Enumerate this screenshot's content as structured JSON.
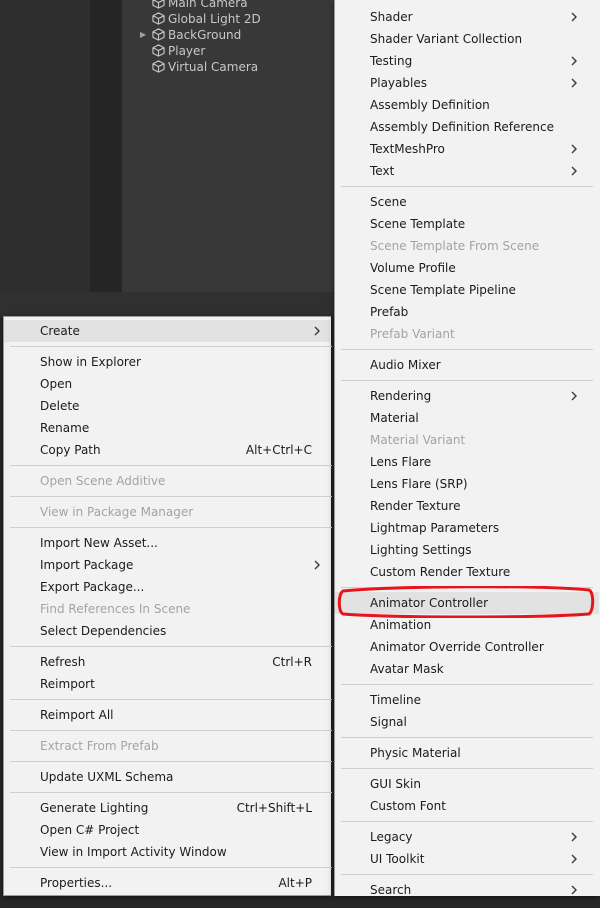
{
  "hierarchy": {
    "items": [
      {
        "label": "Main Camera",
        "expandable": false
      },
      {
        "label": "Global Light 2D",
        "expandable": false
      },
      {
        "label": "BackGround",
        "expandable": true
      },
      {
        "label": "Player",
        "expandable": false
      },
      {
        "label": "Virtual Camera",
        "expandable": false
      }
    ]
  },
  "context_menu": {
    "items": [
      {
        "label": "Create",
        "submenu": true,
        "highlight": true
      },
      {
        "sep": true
      },
      {
        "label": "Show in Explorer"
      },
      {
        "label": "Open"
      },
      {
        "label": "Delete"
      },
      {
        "label": "Rename"
      },
      {
        "label": "Copy Path",
        "shortcut": "Alt+Ctrl+C"
      },
      {
        "sep": true
      },
      {
        "label": "Open Scene Additive",
        "disabled": true
      },
      {
        "sep": true
      },
      {
        "label": "View in Package Manager",
        "disabled": true
      },
      {
        "sep": true
      },
      {
        "label": "Import New Asset..."
      },
      {
        "label": "Import Package",
        "submenu": true
      },
      {
        "label": "Export Package..."
      },
      {
        "label": "Find References In Scene",
        "disabled": true
      },
      {
        "label": "Select Dependencies"
      },
      {
        "sep": true
      },
      {
        "label": "Refresh",
        "shortcut": "Ctrl+R"
      },
      {
        "label": "Reimport"
      },
      {
        "sep": true
      },
      {
        "label": "Reimport All"
      },
      {
        "sep": true
      },
      {
        "label": "Extract From Prefab",
        "disabled": true
      },
      {
        "sep": true
      },
      {
        "label": "Update UXML Schema"
      },
      {
        "sep": true
      },
      {
        "label": "Generate Lighting",
        "shortcut": "Ctrl+Shift+L"
      },
      {
        "label": "Open C# Project"
      },
      {
        "label": "View in Import Activity Window"
      },
      {
        "sep": true
      },
      {
        "label": "Properties...",
        "shortcut": "Alt+P"
      }
    ]
  },
  "create_submenu": {
    "items": [
      {
        "label": "Shader",
        "submenu": true
      },
      {
        "label": "Shader Variant Collection"
      },
      {
        "label": "Testing",
        "submenu": true
      },
      {
        "label": "Playables",
        "submenu": true
      },
      {
        "label": "Assembly Definition"
      },
      {
        "label": "Assembly Definition Reference"
      },
      {
        "label": "TextMeshPro",
        "submenu": true
      },
      {
        "label": "Text",
        "submenu": true
      },
      {
        "sep": true
      },
      {
        "label": "Scene"
      },
      {
        "label": "Scene Template"
      },
      {
        "label": "Scene Template From Scene",
        "disabled": true
      },
      {
        "label": "Volume Profile"
      },
      {
        "label": "Scene Template Pipeline"
      },
      {
        "label": "Prefab"
      },
      {
        "label": "Prefab Variant",
        "disabled": true
      },
      {
        "sep": true
      },
      {
        "label": "Audio Mixer"
      },
      {
        "sep": true
      },
      {
        "label": "Rendering",
        "submenu": true
      },
      {
        "label": "Material"
      },
      {
        "label": "Material Variant",
        "disabled": true
      },
      {
        "label": "Lens Flare"
      },
      {
        "label": "Lens Flare (SRP)"
      },
      {
        "label": "Render Texture"
      },
      {
        "label": "Lightmap Parameters"
      },
      {
        "label": "Lighting Settings"
      },
      {
        "label": "Custom Render Texture"
      },
      {
        "sep": true
      },
      {
        "label": "Animator Controller",
        "highlight": true,
        "annotated": true
      },
      {
        "label": "Animation"
      },
      {
        "label": "Animator Override Controller"
      },
      {
        "label": "Avatar Mask"
      },
      {
        "sep": true
      },
      {
        "label": "Timeline"
      },
      {
        "label": "Signal"
      },
      {
        "sep": true
      },
      {
        "label": "Physic Material"
      },
      {
        "sep": true
      },
      {
        "label": "GUI Skin"
      },
      {
        "label": "Custom Font"
      },
      {
        "sep": true
      },
      {
        "label": "Legacy",
        "submenu": true
      },
      {
        "label": "UI Toolkit",
        "submenu": true
      },
      {
        "sep": true
      },
      {
        "label": "Search",
        "submenu": true
      }
    ]
  },
  "colors": {
    "annotation": "#e8141c",
    "menu_bg": "#f2f2f2",
    "disabled_text": "#a3a3a3",
    "highlight_bg": "#e2e2e2"
  }
}
